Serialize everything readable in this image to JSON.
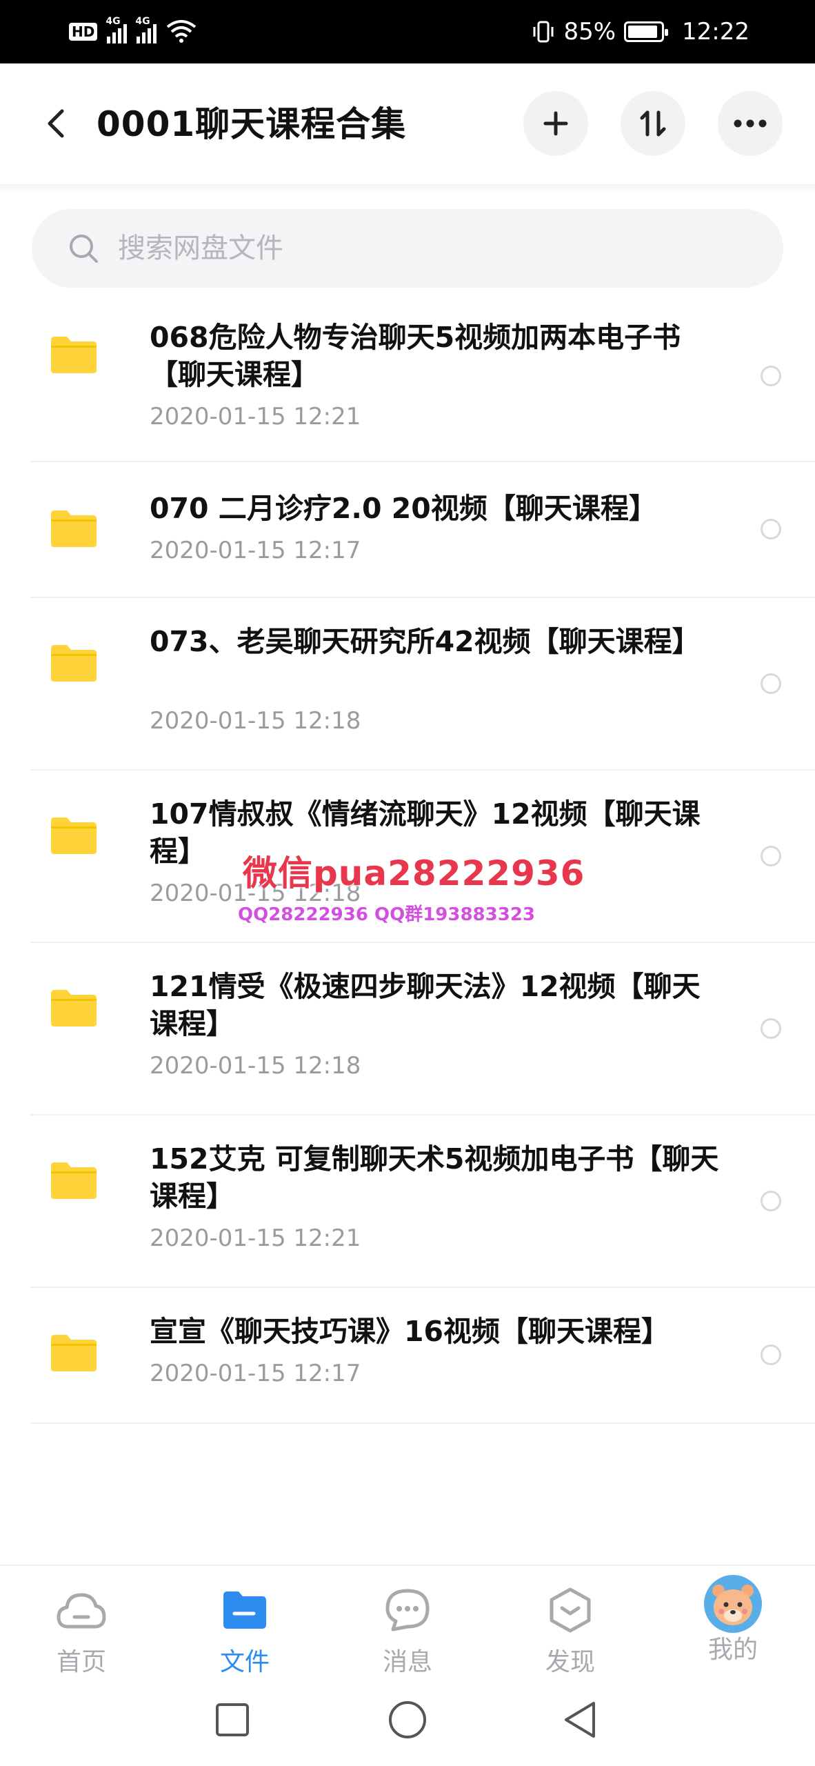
{
  "status_bar": {
    "hd": "HD",
    "signal_1": "4G",
    "signal_2": "4G",
    "battery": "85%",
    "time": "12:22"
  },
  "header": {
    "title": "0001聊天课程合集",
    "icons": [
      "back-icon",
      "plus-icon",
      "sort-icon",
      "more-icon"
    ]
  },
  "search": {
    "placeholder": "搜索网盘文件"
  },
  "files": [
    {
      "name": "068危险人物专治聊天5视频加两本电子书【聊天课程】",
      "date": "2020-01-15  12:21"
    },
    {
      "name": "070 二月诊疗2.0 20视频【聊天课程】",
      "date": "2020-01-15  12:17"
    },
    {
      "name": "073、老吴聊天研究所42视频【聊天课程】",
      "date": "2020-01-15  12:18"
    },
    {
      "name": "107情叔叔《情绪流聊天》12视频【聊天课程】",
      "date": "2020-01-15  12:18"
    },
    {
      "name": "121情受《极速四步聊天法》12视频【聊天课程】",
      "date": "2020-01-15  12:18"
    },
    {
      "name": "152艾克 可复制聊天术5视频加电子书【聊天课程】",
      "date": "2020-01-15  12:21"
    },
    {
      "name": "宣宣《聊天技巧课》16视频【聊天课程】",
      "date": "2020-01-15  12:17"
    }
  ],
  "watermark": {
    "line1": "微信pua28222936",
    "line2": "QQ28222936 QQ群193883323"
  },
  "tabbar": [
    {
      "label": "首页",
      "icon": "cloud-icon",
      "active": false
    },
    {
      "label": "文件",
      "icon": "folder-icon",
      "active": true
    },
    {
      "label": "消息",
      "icon": "chat-icon",
      "active": false
    },
    {
      "label": "发现",
      "icon": "discover-icon",
      "active": false
    },
    {
      "label": "我的",
      "icon": "avatar-icon",
      "active": false
    }
  ],
  "colors": {
    "accent": "#2d8cf0",
    "folder": "#ffd43b",
    "watermark_red": "#e8374c",
    "watermark_purple": "#d34fe0"
  }
}
